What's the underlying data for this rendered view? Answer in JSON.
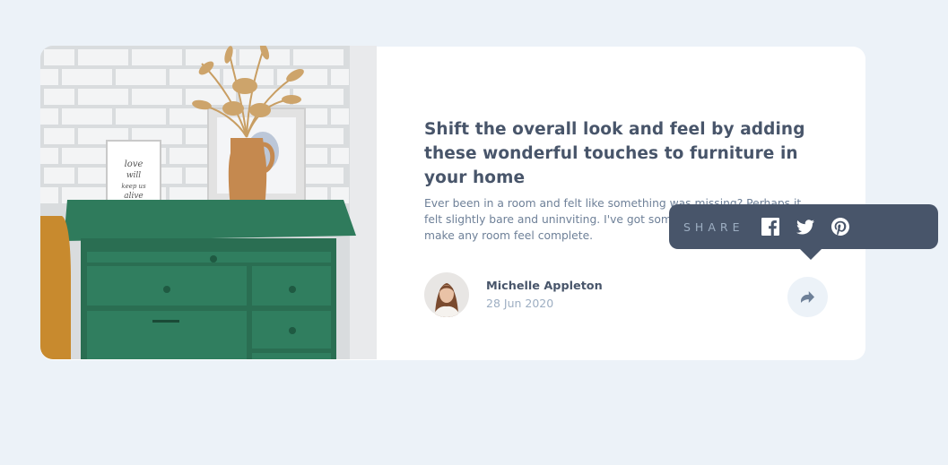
{
  "article": {
    "headline": "Shift the overall look and feel by adding these wonderful touches to furniture in your home",
    "excerpt": "Ever been in a room and felt like something was missing? Perhaps it felt slightly bare and uninviting. I've got some simple tips to help you make any room feel complete.",
    "image_label": "green dresser with vase"
  },
  "author": {
    "name": "Michelle Appleton",
    "date": "28 Jun 2020"
  },
  "share": {
    "label": "SHARE",
    "icons": [
      "facebook-icon",
      "twitter-icon",
      "pinterest-icon"
    ],
    "button_icon": "share-arrow-icon"
  },
  "colors": {
    "background": "#ECF2F8",
    "card": "#FFFFFF",
    "dark_text": "#48556A",
    "muted_text": "#6E8098",
    "light_text": "#9DAEC2",
    "dresser": "#2E7A5A"
  }
}
